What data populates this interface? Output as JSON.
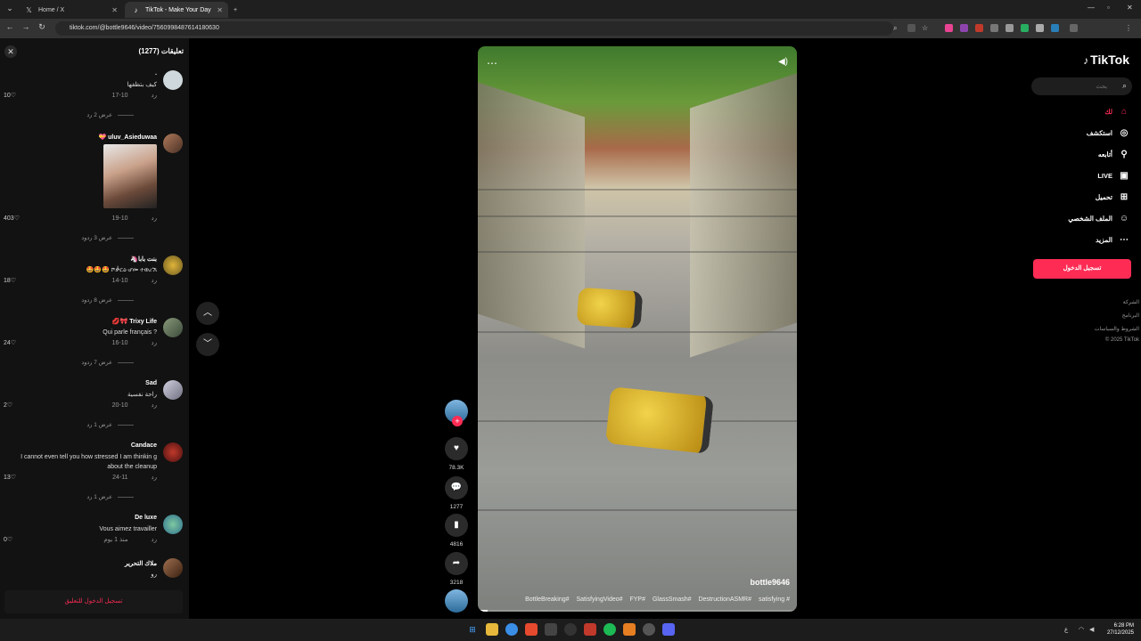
{
  "browser": {
    "tabs": [
      {
        "title": "Home / X",
        "icon": "x-logo-icon"
      },
      {
        "title": "TikTok - Make Your Day",
        "icon": "tiktok-icon"
      }
    ],
    "new_tab": "+",
    "url": "tiktok.com/@bottle9646/video/7560998487614180630"
  },
  "comments_panel": {
    "title": "تعليقات (1277)",
    "items": [
      {
        "author": ".",
        "text": "كيف بتظفها",
        "date": "10-17",
        "reply": "رد",
        "likes": "10",
        "replies": "عرض 2 رد"
      },
      {
        "author": "uluv_Asieduwaa 💝",
        "text": "",
        "date": "10-19",
        "reply": "رد",
        "likes": "403",
        "replies": "عرض 3 ردود"
      },
      {
        "author": "بنت بابا🦄",
        "text": "🤩🤩🤩 ሾቃርዕ·ሆመ ተወረኧ",
        "date": "10-14",
        "reply": "رد",
        "likes": "18",
        "replies": "عرض 8 ردود"
      },
      {
        "author": "Trixy Life 🎀💋",
        "text": "Qui parle français ?",
        "date": "10-16",
        "reply": "رد",
        "likes": "24",
        "replies": "عرض 7 ردود"
      },
      {
        "author": "Sad",
        "text": "راحة نفسية",
        "date": "10-20",
        "reply": "رد",
        "likes": "2",
        "replies": "عرض 1 رد"
      },
      {
        "author": "Candace",
        "text": "I cannot even tell you how stressed I am thinkin g about the cleanup",
        "date": "11-24",
        "reply": "رد",
        "likes": "13",
        "replies": "عرض 1 رد"
      },
      {
        "author": "De luxe",
        "text": "Vous aimez travailler",
        "date": "منذ 1 يوم",
        "reply": "رد",
        "likes": "0",
        "replies": ""
      },
      {
        "author": "ملاك التحرير",
        "text": "رو",
        "date": "",
        "reply": "",
        "likes": "",
        "replies": ""
      }
    ],
    "login_prompt": "تسجيل الدخول للتعليق"
  },
  "video": {
    "username": "bottle9646",
    "hashtags": [
      "satisfying #",
      "DestructionASMR#",
      "GlassSmash#",
      "FYP#",
      "SatisfyingVideo#",
      "BottleBreaking#"
    ],
    "progress": 0.03,
    "actions": {
      "likes": "78.3K",
      "comments": "1277",
      "saves": "4816",
      "shares": "3218"
    }
  },
  "sidebar": {
    "logo": "TikTok",
    "search_placeholder": "بحث",
    "menu": [
      {
        "label": "لك",
        "icon": "home-icon"
      },
      {
        "label": "استكشف",
        "icon": "compass-icon"
      },
      {
        "label": "أتابعه",
        "icon": "user-follow-icon"
      },
      {
        "label": "LIVE",
        "icon": "live-icon"
      },
      {
        "label": "تحميل",
        "icon": "upload-icon"
      },
      {
        "label": "الملف الشخصي",
        "icon": "profile-icon"
      },
      {
        "label": "المزيد",
        "icon": "more-icon"
      }
    ],
    "login": "تسجيل الدخول",
    "footer": [
      "الشركة",
      "البرنامج",
      "الشروط والسياسات",
      "© 2025 TikTok"
    ]
  },
  "taskbar": {
    "time": "6:28 PM",
    "date": "27/12/2025",
    "lang": "ع"
  },
  "colors": {
    "accent": "#fe2c55",
    "panel": "#121212",
    "chrome": "#1f1f1f"
  }
}
